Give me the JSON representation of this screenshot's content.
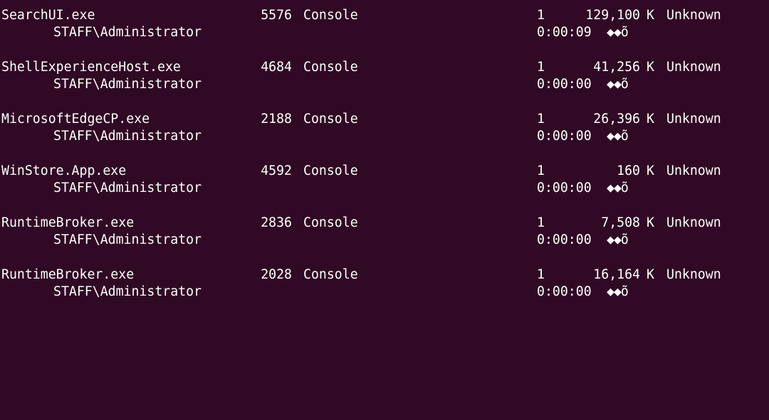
{
  "terminal": {
    "background": "#300a24",
    "foreground": "#ffffff",
    "entries": [
      {
        "image_name": "SearchUI.exe",
        "pid": "5576",
        "session_name": "Console",
        "session_num": "1",
        "mem_usage": "129,100",
        "mem_unit": "K",
        "status": "Unknown",
        "user_name": "STAFF\\Administrator",
        "cpu_time": "0:00:09",
        "window_title": "◆◆õ"
      },
      {
        "image_name": "ShellExperienceHost.exe",
        "pid": "4684",
        "session_name": "Console",
        "session_num": "1",
        "mem_usage": "41,256",
        "mem_unit": "K",
        "status": "Unknown",
        "user_name": "STAFF\\Administrator",
        "cpu_time": "0:00:00",
        "window_title": "◆◆õ"
      },
      {
        "image_name": "MicrosoftEdgeCP.exe",
        "pid": "2188",
        "session_name": "Console",
        "session_num": "1",
        "mem_usage": "26,396",
        "mem_unit": "K",
        "status": "Unknown",
        "user_name": "STAFF\\Administrator",
        "cpu_time": "0:00:00",
        "window_title": "◆◆õ"
      },
      {
        "image_name": "WinStore.App.exe",
        "pid": "4592",
        "session_name": "Console",
        "session_num": "1",
        "mem_usage": "160",
        "mem_unit": "K",
        "status": "Unknown",
        "user_name": "STAFF\\Administrator",
        "cpu_time": "0:00:00",
        "window_title": "◆◆õ"
      },
      {
        "image_name": "RuntimeBroker.exe",
        "pid": "2836",
        "session_name": "Console",
        "session_num": "1",
        "mem_usage": "7,508",
        "mem_unit": "K",
        "status": "Unknown",
        "user_name": "STAFF\\Administrator",
        "cpu_time": "0:00:00",
        "window_title": "◆◆õ"
      },
      {
        "image_name": "RuntimeBroker.exe",
        "pid": "2028",
        "session_name": "Console",
        "session_num": "1",
        "mem_usage": "16,164",
        "mem_unit": "K",
        "status": "Unknown",
        "user_name": "STAFF\\Administrator",
        "cpu_time": "0:00:00",
        "window_title": "◆◆õ"
      }
    ]
  }
}
